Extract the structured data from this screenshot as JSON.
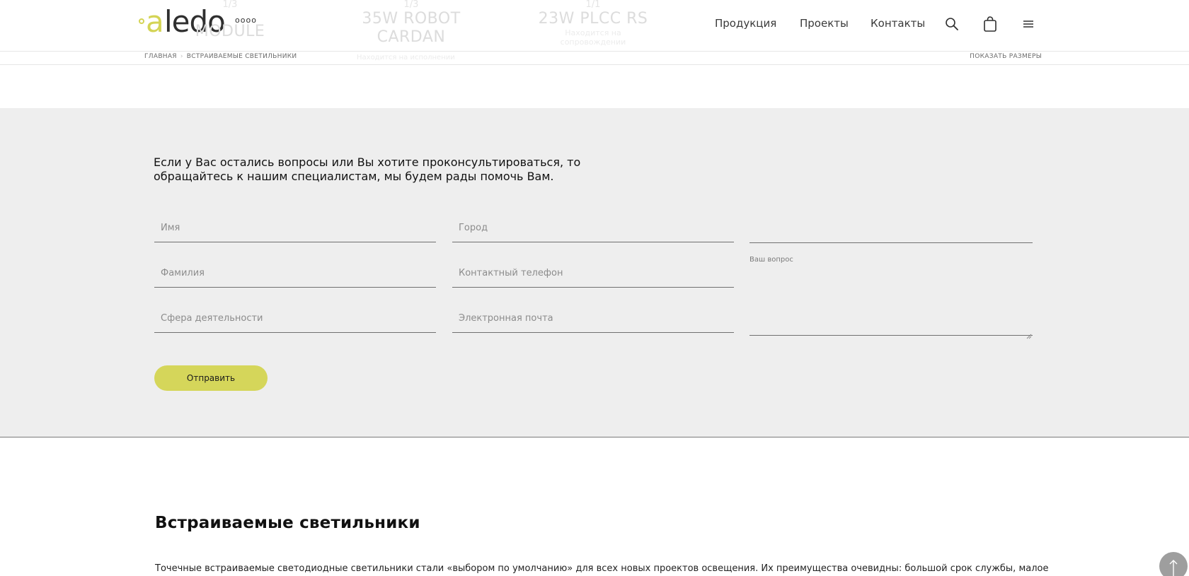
{
  "header": {
    "logo": {
      "text_a": "a",
      "text_rest": "ledo",
      "rings": "oooo"
    },
    "ghost_products": [
      {
        "counter": "1/3",
        "name_line1": "…",
        "name_line2": "MODULE",
        "sub": ""
      },
      {
        "counter": "1/3",
        "name_line1": "35W ROBOT",
        "name_line2": "CARDAN",
        "sub": "Находится на исполнении"
      },
      {
        "counter": "1/1",
        "name_line1": "23W PLCC RS",
        "name_line2": "",
        "sub": "Находится на сопровождении"
      }
    ],
    "nav": [
      "Продукция",
      "Проекты",
      "Контакты"
    ],
    "icons": {
      "search": "search-icon",
      "cart": "shopping-bag-icon",
      "menu": "hamburger-menu-icon"
    }
  },
  "breadcrumb": {
    "items": [
      "ГЛАВНАЯ",
      "ВСТРАИВАЕМЫЕ СВЕТИЛЬНИКИ"
    ],
    "ghost": "Находится на исполнении",
    "show_sizes": "ПОКАЗАТЬ РАЗМЕРЫ"
  },
  "form": {
    "intro_line1": "Если у Вас остались вопросы или Вы хотите проконсультироваться, то",
    "intro_line2": "обращайтесь к нашим специалистам, мы будем рады помочь Вам.",
    "fields": {
      "name": "Имя",
      "city": "Город",
      "surname": "Фамилия",
      "phone": "Контактный телефон",
      "activity": "Сфера деятельности",
      "email": "Электронная почта"
    },
    "question_label": "Ваш вопрос",
    "submit_label": "Отправить"
  },
  "seo": {
    "title": "Встраиваемые светильники",
    "text": "Точечные встраиваемые светодиодные светильники стали «выбором по умолчанию» для всех новых проектов освещения. Их преимущества очевидны: большой срок службы, малое"
  },
  "colors": {
    "accent": "#d5d65a",
    "form_bg": "#eeeeee",
    "text": "#111111"
  }
}
